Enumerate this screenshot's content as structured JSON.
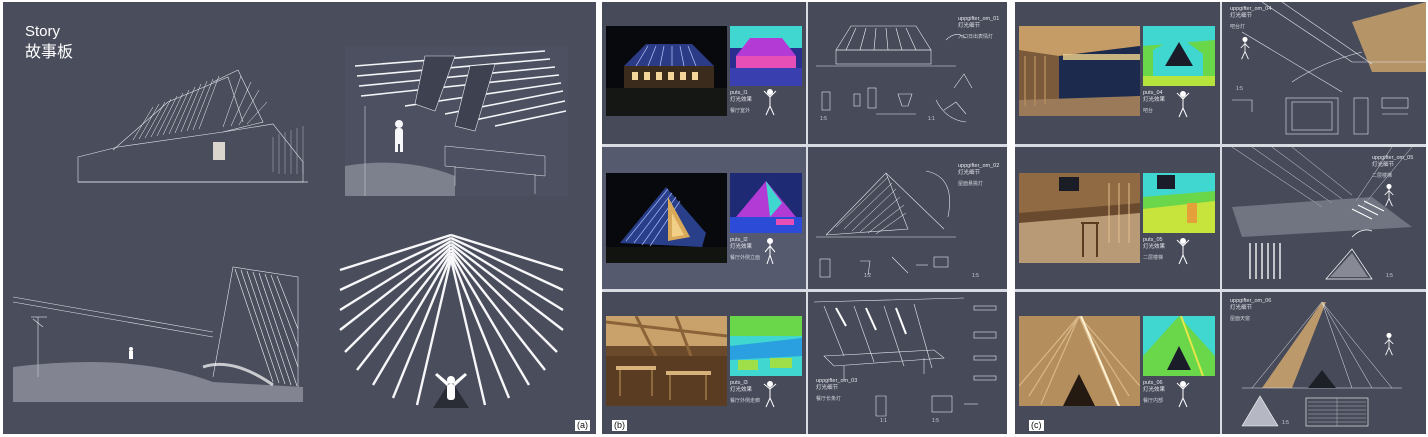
{
  "panels": {
    "a": {
      "label": "(a)",
      "title": "Story",
      "subtitle": "故事板"
    },
    "b": {
      "label": "(b)",
      "rows": [
        {
          "render_code": "puts_l1",
          "render_title": "灯光效果",
          "render_note": "餐厅室外",
          "detail_code": "uppgifter_om_01",
          "detail_title": "灯光细节",
          "detail_note": "入口日出表情灯",
          "mark1": "1:5",
          "mark2": "1:1"
        },
        {
          "render_code": "puts_l2",
          "render_title": "灯光效果",
          "render_note": "餐厅外侧立面",
          "detail_code": "uppgifter_om_02",
          "detail_title": "灯光细节",
          "detail_note": "屋面悬挑灯",
          "mark1": "1:2",
          "mark2": "1:5"
        },
        {
          "render_code": "puts_l3",
          "render_title": "灯光效果",
          "render_note": "餐厅外侧走廊",
          "detail_code": "uppgifter_om_03",
          "detail_title": "灯光细节",
          "detail_note": "餐厅长条灯",
          "mark1": "1:1",
          "mark2": "1:5"
        }
      ]
    },
    "c": {
      "label": "(c)",
      "rows": [
        {
          "render_code": "puts_04",
          "render_title": "灯光效果",
          "render_note": "吧台",
          "detail_code": "uppgifter_om_04",
          "detail_title": "灯光细节",
          "detail_note": "吧台灯",
          "mark1": "1:5"
        },
        {
          "render_code": "puts_05",
          "render_title": "灯光效果",
          "render_note": "二层楼梯",
          "detail_code": "uppgifter_om_05",
          "detail_title": "灯光细节",
          "detail_note": "二层楼梯",
          "mark1": "1:5"
        },
        {
          "render_code": "puts_06",
          "render_title": "灯光效果",
          "render_note": "餐厅内部",
          "detail_code": "uppgifter_om_06",
          "detail_title": "灯光细节",
          "detail_note": "屋面天窗",
          "mark1": "1:5"
        }
      ]
    }
  },
  "colors": {
    "panel_bg": "#4a4d5c",
    "cell_bg": "#474a59",
    "divider": "#d9dbe3",
    "sketch": "#e6e7ee",
    "warm_light": "#c9a26b",
    "false_color_cyan": "#3fd7d0",
    "false_color_green": "#6ad64a"
  }
}
